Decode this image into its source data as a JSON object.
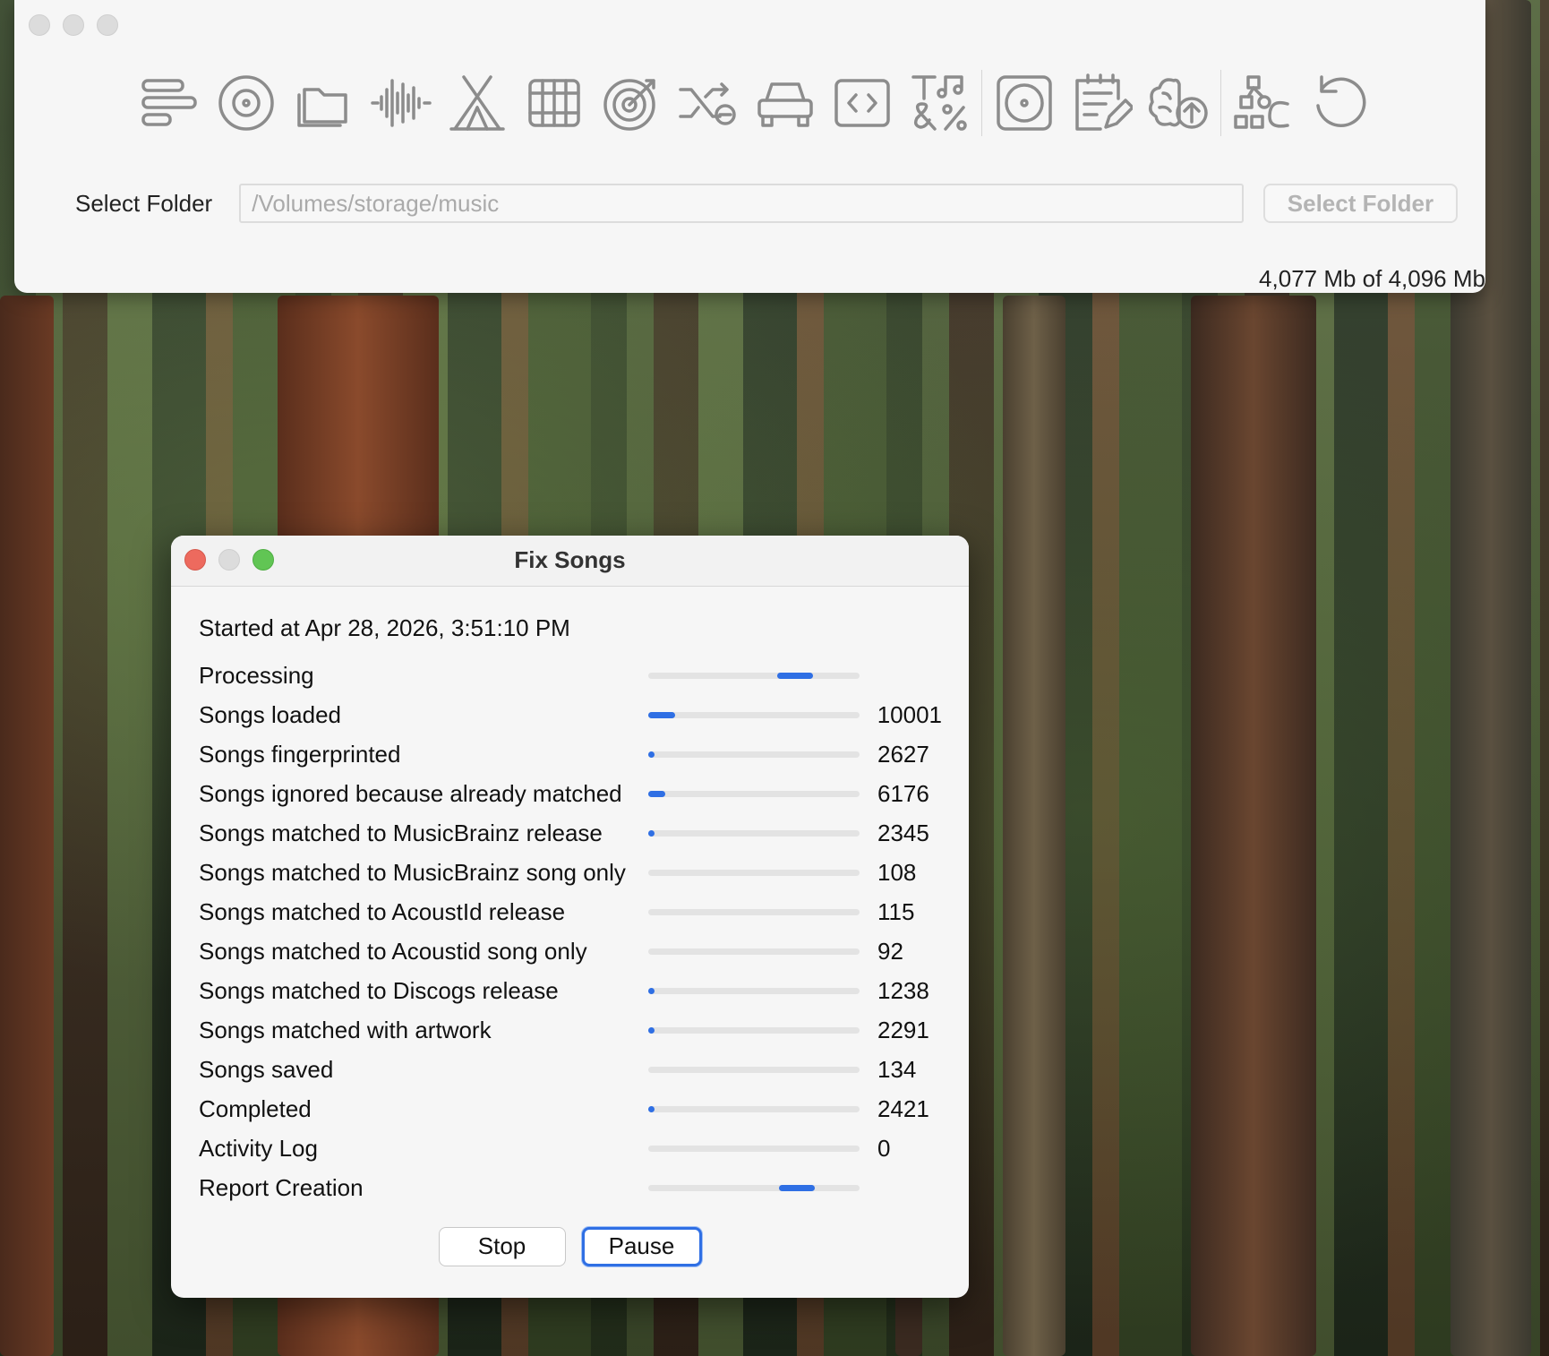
{
  "main_window": {
    "folder_label": "Select Folder",
    "folder_path": "/Volumes/storage/music",
    "folder_button": "Select Folder",
    "memory": "4,077 Mb of 4,096 Mb"
  },
  "toolbar_icons": [
    "list-icon",
    "disc-icon",
    "folder-icon",
    "waveform-icon",
    "tent-icon",
    "grid-icon",
    "target-icon",
    "shuffle-icon",
    "car-icon",
    "code-icon",
    "text-music-percent-icon",
    "record-icon",
    "edit-list-icon",
    "brain-upload-icon",
    "shapes-icon",
    "undo-icon"
  ],
  "dialog": {
    "title": "Fix Songs",
    "started": "Started at Apr 28, 2026, 3:51:10 PM",
    "rows": [
      {
        "label": "Processing",
        "value": "",
        "fill_start": 0.61,
        "fill": 0.17
      },
      {
        "label": "Songs loaded",
        "value": "10001",
        "fill_start": 0.0,
        "fill": 0.13
      },
      {
        "label": "Songs fingerprinted",
        "value": "2627",
        "fill_start": 0.0,
        "fill": 0.03
      },
      {
        "label": "Songs ignored because already matched",
        "value": "6176",
        "fill_start": 0.0,
        "fill": 0.08
      },
      {
        "label": "Songs matched to MusicBrainz release",
        "value": "2345",
        "fill_start": 0.0,
        "fill": 0.03
      },
      {
        "label": "Songs matched to MusicBrainz song only",
        "value": "108",
        "fill_start": 0.0,
        "fill": 0.0
      },
      {
        "label": "Songs matched to AcoustId release",
        "value": "115",
        "fill_start": 0.0,
        "fill": 0.0
      },
      {
        "label": "Songs matched to Acoustid song only",
        "value": "92",
        "fill_start": 0.0,
        "fill": 0.0
      },
      {
        "label": "Songs matched to Discogs release",
        "value": "1238",
        "fill_start": 0.0,
        "fill": 0.015
      },
      {
        "label": "Songs matched with artwork",
        "value": "2291",
        "fill_start": 0.0,
        "fill": 0.03
      },
      {
        "label": "Songs saved",
        "value": "134",
        "fill_start": 0.0,
        "fill": 0.0
      },
      {
        "label": "Completed",
        "value": "2421",
        "fill_start": 0.0,
        "fill": 0.03
      },
      {
        "label": "Activity Log",
        "value": "0",
        "fill_start": 0.0,
        "fill": 0.0
      },
      {
        "label": "Report Creation",
        "value": "",
        "fill_start": 0.62,
        "fill": 0.17
      }
    ],
    "stop_label": "Stop",
    "pause_label": "Pause"
  },
  "colors": {
    "accent": "#2f6fe4"
  }
}
